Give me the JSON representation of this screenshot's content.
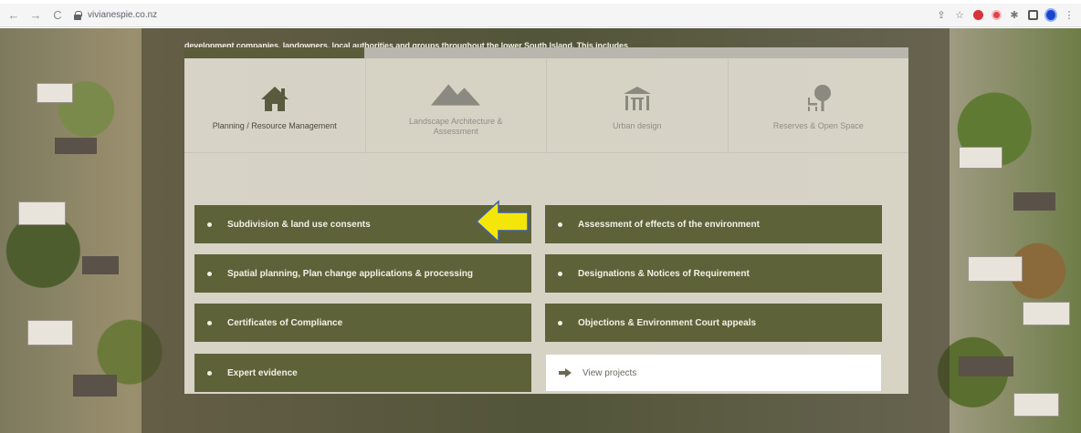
{
  "browser": {
    "url": "vivianespie.co.nz",
    "back_glyph": "←",
    "forward_glyph": "→",
    "reload_glyph": "C"
  },
  "intro": {
    "text": "development companies, landowners, local authorities and groups throughout the lower South Island. This includes"
  },
  "tabs": [
    {
      "label": "Planning / Resource Management",
      "icon": "house-icon",
      "active": true
    },
    {
      "label": "Landscape Architecture & Assessment",
      "icon": "mountain-icon",
      "active": false
    },
    {
      "label": "Urban design",
      "icon": "building-icon",
      "active": false
    },
    {
      "label": "Reserves & Open Space",
      "icon": "tree-bench-icon",
      "active": false
    }
  ],
  "services": {
    "left": [
      "Subdivision & land use consents",
      "Spatial planning, Plan change applications & processing",
      "Certificates of Compliance",
      "Expert evidence"
    ],
    "right": [
      "Assessment of effects of the environment",
      "Designations & Notices of Requirement",
      "Objections & Environment Court appeals"
    ],
    "view_projects": "View projects"
  },
  "colors": {
    "item_bg": "#5e6239",
    "highlight_arrow": "#f5e60a",
    "tab_active": "#5b5c3a"
  }
}
